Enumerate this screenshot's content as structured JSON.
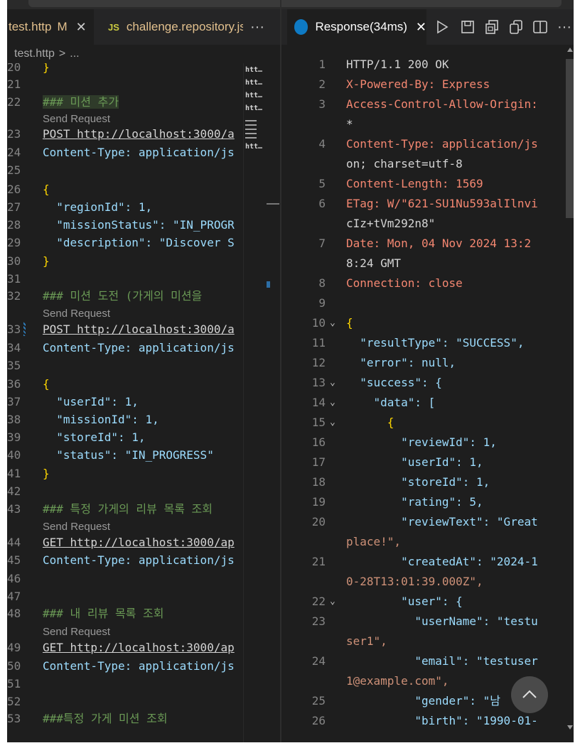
{
  "tabs_left": {
    "file_tab": {
      "label": "test.http",
      "badge": "M",
      "close": "✕"
    },
    "js_tab": {
      "icon": "JS",
      "label": "challenge.repository.js"
    },
    "more": "···"
  },
  "tabs_right": {
    "response_tab": {
      "label": "Response(34ms)",
      "close": "✕"
    },
    "more": "···"
  },
  "breadcrumb": {
    "file": "test.http",
    "sep": ">",
    "rest": "..."
  },
  "editor": {
    "send_request": "Send Request",
    "lines": [
      {
        "n": "20",
        "t": "}"
      },
      {
        "n": "21",
        "t": ""
      },
      {
        "n": "22",
        "t": "### 미션 추가"
      },
      {
        "n": "23",
        "t": "POST http://localhost:3000/a"
      },
      {
        "n": "24",
        "t": "Content-Type: application/js"
      },
      {
        "n": "25",
        "t": ""
      },
      {
        "n": "26",
        "t": "{"
      },
      {
        "n": "27",
        "t": "  \"regionId\": 1,"
      },
      {
        "n": "28",
        "t": "  \"missionStatus\": \"IN_PROGR"
      },
      {
        "n": "29",
        "t": "  \"description\": \"Discover S"
      },
      {
        "n": "30",
        "t": "}"
      },
      {
        "n": "31",
        "t": ""
      },
      {
        "n": "32",
        "t": "### 미션 도전 (가게의 미션을"
      },
      {
        "n": "33",
        "t": "POST http://localhost:3000/a"
      },
      {
        "n": "34",
        "t": "Content-Type: application/js"
      },
      {
        "n": "35",
        "t": ""
      },
      {
        "n": "36",
        "t": "{"
      },
      {
        "n": "37",
        "t": "  \"userId\": 1,"
      },
      {
        "n": "38",
        "t": "  \"missionId\": 1,"
      },
      {
        "n": "39",
        "t": "  \"storeId\": 1,"
      },
      {
        "n": "40",
        "t": "  \"status\": \"IN_PROGRESS\""
      },
      {
        "n": "41",
        "t": "}"
      },
      {
        "n": "42",
        "t": ""
      },
      {
        "n": "43",
        "t": "### 특정 가게의 리뷰 목록 조회"
      },
      {
        "n": "44",
        "t": "GET http://localhost:3000/ap"
      },
      {
        "n": "45",
        "t": "Content-Type: application/js"
      },
      {
        "n": "46",
        "t": ""
      },
      {
        "n": "47",
        "t": ""
      },
      {
        "n": "48",
        "t": "### 내 리뷰 목록 조회"
      },
      {
        "n": "49",
        "t": "GET http://localhost:3000/ap"
      },
      {
        "n": "50",
        "t": "Content-Type: application/js"
      },
      {
        "n": "51",
        "t": ""
      },
      {
        "n": "52",
        "t": ""
      },
      {
        "n": "53",
        "t": "###특정 가게 미션 조회"
      }
    ],
    "minimap": [
      "htt…",
      "htt…",
      "htt…",
      "htt…",
      "htt…"
    ]
  },
  "response": {
    "lines": [
      {
        "n": "1",
        "t": "HTTP/1.1 200 OK"
      },
      {
        "n": "2",
        "t": "X-Powered-By: Express"
      },
      {
        "n": "3",
        "t": "Access-Control-Allow-Origin:"
      },
      {
        "n": "",
        "t": "*"
      },
      {
        "n": "4",
        "t": "Content-Type: application/js"
      },
      {
        "n": "",
        "t": "on; charset=utf-8"
      },
      {
        "n": "5",
        "t": "Content-Length: 1569"
      },
      {
        "n": "6",
        "t": "ETag: W/\"621-SU1Nu593alIlnvi"
      },
      {
        "n": "",
        "t": "cIz+tVm292n8\""
      },
      {
        "n": "7",
        "t": "Date: Mon, 04 Nov 2024 13:2"
      },
      {
        "n": "",
        "t": "8:24 GMT"
      },
      {
        "n": "8",
        "t": "Connection: close"
      },
      {
        "n": "9",
        "t": ""
      },
      {
        "n": "10",
        "t": "{"
      },
      {
        "n": "11",
        "t": "  \"resultType\": \"SUCCESS\","
      },
      {
        "n": "12",
        "t": "  \"error\": null,"
      },
      {
        "n": "13",
        "t": "  \"success\": {"
      },
      {
        "n": "14",
        "t": "    \"data\": ["
      },
      {
        "n": "15",
        "t": "      {"
      },
      {
        "n": "16",
        "t": "        \"reviewId\": 1,"
      },
      {
        "n": "17",
        "t": "        \"userId\": 1,"
      },
      {
        "n": "18",
        "t": "        \"storeId\": 1,"
      },
      {
        "n": "19",
        "t": "        \"rating\": 5,"
      },
      {
        "n": "20",
        "t": "        \"reviewText\": \"Great"
      },
      {
        "n": "",
        "t": "place!\","
      },
      {
        "n": "21",
        "t": "        \"createdAt\": \"2024-1"
      },
      {
        "n": "",
        "t": "0-28T13:01:39.000Z\","
      },
      {
        "n": "22",
        "t": "        \"user\": {"
      },
      {
        "n": "23",
        "t": "          \"userName\": \"testu"
      },
      {
        "n": "",
        "t": "ser1\","
      },
      {
        "n": "24",
        "t": "          \"email\": \"testuser"
      },
      {
        "n": "",
        "t": "1@example.com\","
      },
      {
        "n": "25",
        "t": "          \"gender\": \"남"
      },
      {
        "n": "26",
        "t": "          \"birth\": \"1990-01-"
      }
    ]
  },
  "colors": {
    "editor_bg": "#1e1e1e",
    "tab_bar": "#252526",
    "comment": "#6a9955",
    "keyword": "#569cd6",
    "json_key": "#9cdcfe",
    "string": "#ce9178",
    "number": "#b5cea8",
    "brace": "#ffd700",
    "header_key": "#f48771",
    "modified": "#e2c08d"
  },
  "icons": [
    "close-icon",
    "js-file-icon",
    "response-icon",
    "run-icon",
    "save-icon",
    "copy-all-icon",
    "copy-icon",
    "split-editor-icon",
    "more-icon",
    "chevron-down-icon",
    "scroll-to-top-icon"
  ]
}
